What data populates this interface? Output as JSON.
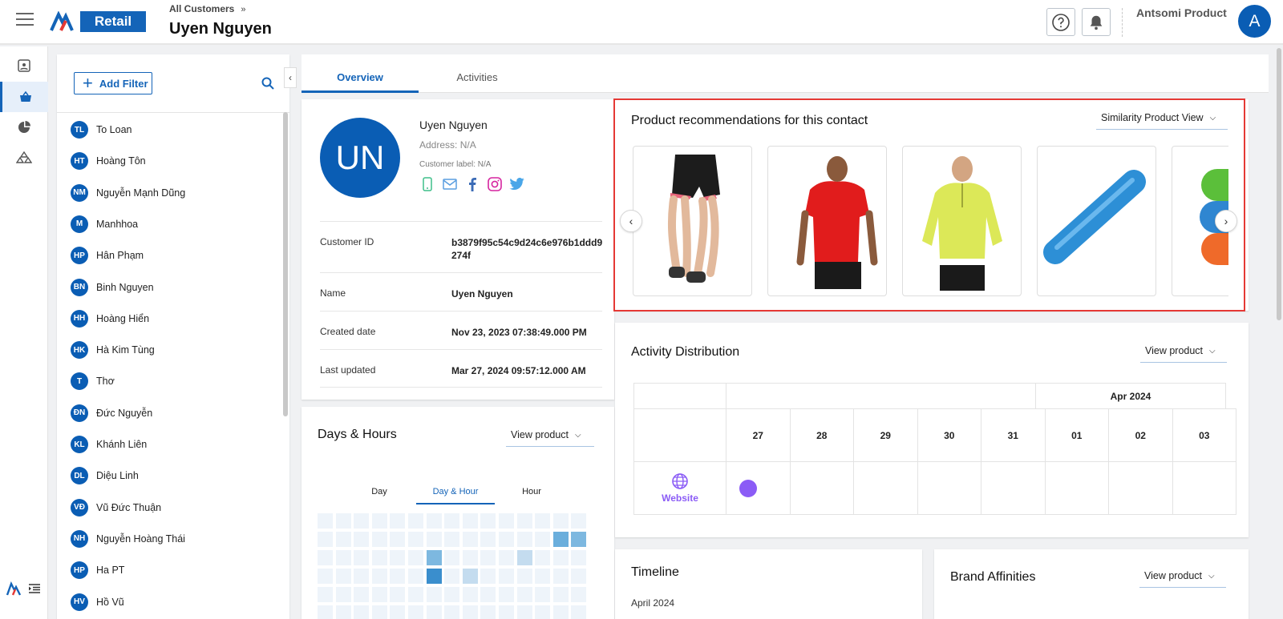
{
  "header": {
    "logo_text": "Retail",
    "breadcrumb": "All Customers",
    "breadcrumb_sep": "»",
    "title": "Uyen Nguyen",
    "portal_name": "Antsomi Product",
    "avatar_letter": "A",
    "icons": [
      "menu-icon",
      "help-icon",
      "bell-icon"
    ]
  },
  "rail": {
    "icons": [
      "contact-card-icon",
      "shopping-basket-icon",
      "pie-chart-icon",
      "triangles-icon",
      "antsomi-logo-icon",
      "menu-indent-icon"
    ],
    "active_index": 1,
    "accent": "#1464b8"
  },
  "list": {
    "add_filter": "Add Filter",
    "customers": [
      {
        "initials": "TL",
        "name": "To Loan"
      },
      {
        "initials": "HT",
        "name": "Hoàng Tôn"
      },
      {
        "initials": "NM",
        "name": "Nguyễn Mạnh Dũng"
      },
      {
        "initials": "M",
        "name": "Manhhoa"
      },
      {
        "initials": "HP",
        "name": "Hân Phạm"
      },
      {
        "initials": "BN",
        "name": "Binh Nguyen"
      },
      {
        "initials": "HH",
        "name": "Hoàng Hiển"
      },
      {
        "initials": "HK",
        "name": "Hà Kim Tùng"
      },
      {
        "initials": "T",
        "name": "Thơ"
      },
      {
        "initials": "ĐN",
        "name": "Đức Nguyễn"
      },
      {
        "initials": "KL",
        "name": "Khánh Liên"
      },
      {
        "initials": "DL",
        "name": "Diệu Linh"
      },
      {
        "initials": "VĐ",
        "name": "Vũ Đức Thuận"
      },
      {
        "initials": "NH",
        "name": "Nguyễn Hoàng Thái"
      },
      {
        "initials": "HP",
        "name": "Ha PT"
      },
      {
        "initials": "HV",
        "name": "Hồ Vũ"
      }
    ]
  },
  "tabs": [
    {
      "label": "Overview",
      "active": true
    },
    {
      "label": "Activities",
      "active": false
    }
  ],
  "profile": {
    "initials": "UN",
    "name": "Uyen Nguyen",
    "address": "Address: N/A",
    "customer_label": "Customer label: N/A",
    "social_icons": [
      "phone-icon",
      "email-icon",
      "facebook-icon",
      "instagram-icon",
      "twitter-icon"
    ],
    "fields": [
      {
        "key": "Customer ID",
        "value": "b3879f95c54c9d24c6e976b1ddd9274f"
      },
      {
        "key": "Name",
        "value": "Uyen Nguyen"
      },
      {
        "key": "Created date",
        "value": "Nov 23, 2023 07:38:49.000 PM"
      },
      {
        "key": "Last updated",
        "value": "Mar 27, 2024 09:57:12.000 AM"
      }
    ]
  },
  "days_hours": {
    "title": "Days & Hours",
    "dropdown": "View product",
    "subtabs": [
      "Day",
      "Day & Hour",
      "Hour"
    ],
    "active_subtab": 1,
    "highlighted_cells": [
      {
        "row": 1,
        "col": 13,
        "level": "#6aaedc"
      },
      {
        "row": 1,
        "col": 14,
        "level": "#7db8e0"
      },
      {
        "row": 2,
        "col": 6,
        "level": "#7db8e0"
      },
      {
        "row": 2,
        "col": 11,
        "level": "#c4dcef"
      },
      {
        "row": 3,
        "col": 6,
        "level": "#3a8ecd"
      },
      {
        "row": 3,
        "col": 8,
        "level": "#c4dcef"
      }
    ]
  },
  "recommendations": {
    "title": "Product recommendations for this contact",
    "dropdown": "Similarity Product View",
    "products": [
      "running-shorts",
      "red-t-shirt",
      "yellow-pullover",
      "blue-foam-roller",
      "resistance-bands"
    ]
  },
  "activity": {
    "title": "Activity Distribution",
    "dropdown": "View product",
    "month": "Apr 2024",
    "days": [
      "27",
      "28",
      "29",
      "30",
      "31",
      "01",
      "02",
      "03"
    ],
    "channel": "Website",
    "dot_color": "#8b5cf6"
  },
  "timeline": {
    "title": "Timeline",
    "month": "April 2024"
  },
  "brand": {
    "title": "Brand Affinities",
    "dropdown": "View product"
  }
}
